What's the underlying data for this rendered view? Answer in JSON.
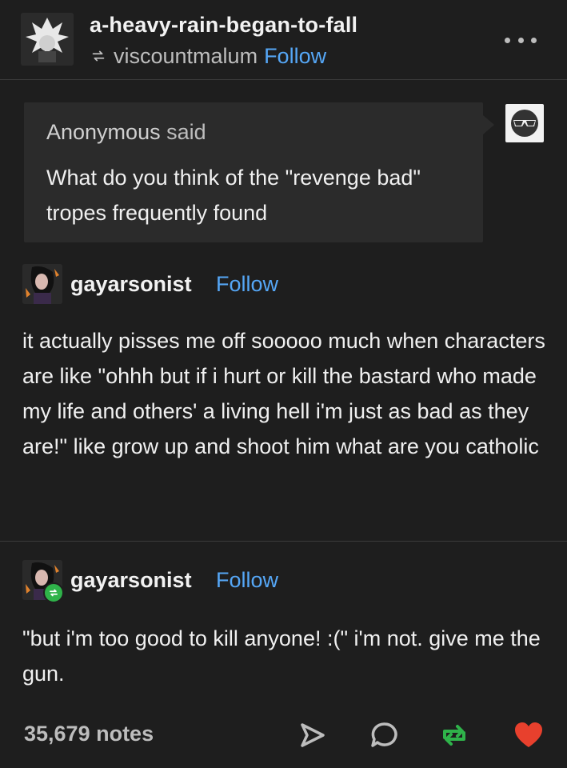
{
  "header": {
    "blog_name": "a-heavy-rain-began-to-fall",
    "reblogged_from": "viscountmalum",
    "follow_label": "Follow"
  },
  "ask": {
    "asker": "Anonymous",
    "said": "said",
    "question": "What do you think of the \"revenge bad\" tropes frequently found"
  },
  "posts": [
    {
      "username": "gayarsonist",
      "follow_label": "Follow",
      "body": "it actually pisses me off sooooo much when characters are like \"ohhh but if i hurt or kill the bastard who made my life and others' a living hell i'm just as bad as they are!\" like grow up and shoot him what are you catholic"
    },
    {
      "username": "gayarsonist",
      "follow_label": "Follow",
      "body": "\"but i'm too good to kill anyone! :(\" i'm not. give me the gun."
    }
  ],
  "footer": {
    "notes": "35,679 notes",
    "icons": [
      "share-icon",
      "reply-icon",
      "reblog-icon",
      "like-icon"
    ]
  },
  "colors": {
    "background": "#1e1e1e",
    "link": "#55a6f5",
    "reblog": "#2fb34a",
    "like": "#e8402d"
  }
}
